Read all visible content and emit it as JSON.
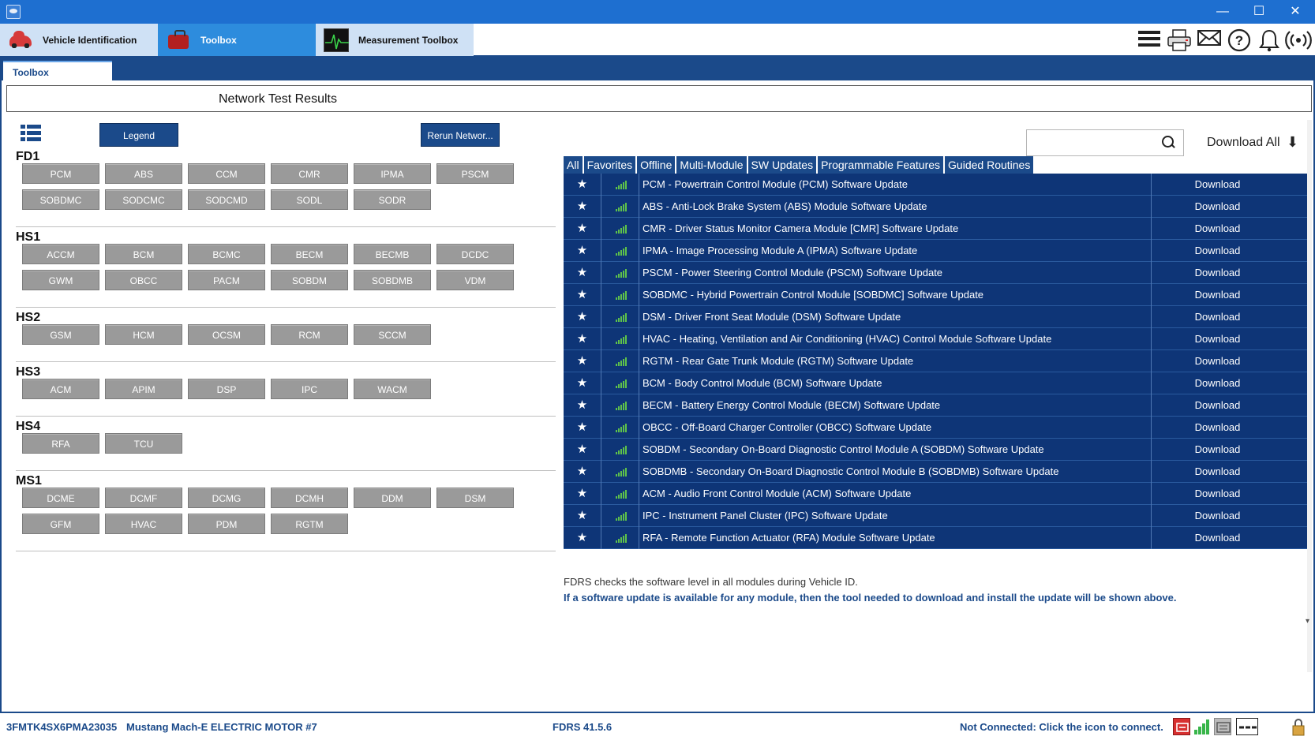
{
  "window": {
    "minimize": "—",
    "maximize": "☐",
    "close": "✕"
  },
  "ribbon": {
    "tabs": [
      {
        "label": "Vehicle Identification",
        "icon": "car-icon"
      },
      {
        "label": "Toolbox",
        "icon": "toolbox-icon"
      },
      {
        "label": "Measurement Toolbox",
        "icon": "oscilloscope-icon"
      }
    ],
    "icons": [
      "menu-icon",
      "printer-icon",
      "mail-icon",
      "help-icon",
      "bell-icon",
      "broadcast-icon"
    ]
  },
  "subtab": {
    "label": "Toolbox"
  },
  "results": {
    "title": "Network Test Results",
    "legend_label": "Legend",
    "rerun_label": "Rerun Networ...",
    "download_all_label": "Download All"
  },
  "networks": [
    {
      "name": "FD1",
      "modules": [
        "PCM",
        "ABS",
        "CCM",
        "CMR",
        "IPMA",
        "PSCM",
        "SOBDMC",
        "SODCMC",
        "SODCMD",
        "SODL",
        "SODR"
      ]
    },
    {
      "name": "HS1",
      "modules": [
        "ACCM",
        "BCM",
        "BCMC",
        "BECM",
        "BECMB",
        "DCDC",
        "GWM",
        "OBCC",
        "PACM",
        "SOBDM",
        "SOBDMB",
        "VDM"
      ]
    },
    {
      "name": "HS2",
      "modules": [
        "GSM",
        "HCM",
        "OCSM",
        "RCM",
        "SCCM"
      ]
    },
    {
      "name": "HS3",
      "modules": [
        "ACM",
        "APIM",
        "DSP",
        "IPC",
        "WACM"
      ]
    },
    {
      "name": "HS4",
      "modules": [
        "RFA",
        "TCU"
      ]
    },
    {
      "name": "MS1",
      "modules": [
        "DCME",
        "DCMF",
        "DCMG",
        "DCMH",
        "DDM",
        "DSM",
        "GFM",
        "HVAC",
        "PDM",
        "RGTM"
      ]
    }
  ],
  "filters": [
    "All",
    "Favorites",
    "Offline",
    "Multi-Module",
    "SW Updates",
    "Programmable Features",
    "Guided Routines"
  ],
  "updates": [
    {
      "desc": "PCM - Powertrain Control Module (PCM) Software Update",
      "action": "Download"
    },
    {
      "desc": "ABS - Anti-Lock Brake System (ABS) Module Software Update",
      "action": "Download"
    },
    {
      "desc": "CMR - Driver Status Monitor Camera Module [CMR] Software Update",
      "action": "Download"
    },
    {
      "desc": "IPMA - Image Processing Module A (IPMA) Software Update",
      "action": "Download"
    },
    {
      "desc": "PSCM - Power Steering Control Module (PSCM) Software Update",
      "action": "Download"
    },
    {
      "desc": "SOBDMC - Hybrid Powertrain Control Module [SOBDMC] Software Update",
      "action": "Download"
    },
    {
      "desc": "DSM - Driver Front Seat Module (DSM) Software Update",
      "action": "Download"
    },
    {
      "desc": "HVAC - Heating, Ventilation and Air Conditioning (HVAC) Control Module Software Update",
      "action": "Download"
    },
    {
      "desc": "RGTM - Rear Gate Trunk Module (RGTM) Software Update",
      "action": "Download"
    },
    {
      "desc": "BCM - Body Control Module (BCM) Software Update",
      "action": "Download"
    },
    {
      "desc": "BECM - Battery Energy Control Module (BECM) Software Update",
      "action": "Download"
    },
    {
      "desc": "OBCC - Off-Board Charger Controller (OBCC) Software Update",
      "action": "Download"
    },
    {
      "desc": "SOBDM - Secondary On-Board Diagnostic Control Module A (SOBDM) Software Update",
      "action": "Download"
    },
    {
      "desc": "SOBDMB - Secondary On-Board Diagnostic Control Module B (SOBDMB) Software Update",
      "action": "Download"
    },
    {
      "desc": "ACM - Audio Front Control Module (ACM) Software Update",
      "action": "Download"
    },
    {
      "desc": "IPC - Instrument Panel Cluster (IPC) Software Update",
      "action": "Download"
    },
    {
      "desc": "RFA - Remote Function Actuator (RFA) Module Software Update",
      "action": "Download"
    }
  ],
  "info": {
    "line1": "FDRS checks the software level in all modules during Vehicle ID.",
    "line2": "If a software update is available for any module, then the tool needed to download and install the update will be shown above."
  },
  "status": {
    "vin": "3FMTK4SX6PMA23035",
    "vehicle": "Mustang Mach-E ELECTRIC MOTOR #7",
    "version": "FDRS 41.5.6",
    "connection": "Not Connected: Click the icon to connect."
  },
  "colors": {
    "accent": "#1b4a8a",
    "row_bg": "#0e3577",
    "module_btn": "#9a9a9a",
    "signal": "#5ec24a"
  }
}
